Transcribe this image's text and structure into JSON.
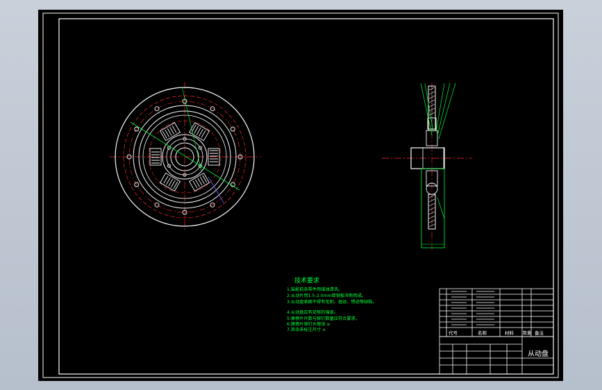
{
  "drawing": {
    "title_block_name": "从动盘",
    "technical_requirements": {
      "heading": "技术要求",
      "lines": [
        "1.装配前各零件用煤油清洗。",
        "2.从动片用1.5-2.0mm厚钢板冲制而成。",
        "3.从动盘表面不得有毛刺、斑纹、锈迹等缺陷。",
        "4.从动盘应有足够的强度。",
        "5.摩擦片片数与铆钉数量应符合要求。",
        "6.摩擦片铆钉头埋深 ≥",
        "7.其余未标注尺寸 ±"
      ]
    },
    "title_block": {
      "header_cells": [
        "代号",
        "名称",
        "材料",
        "数量",
        "备注"
      ]
    },
    "colors": {
      "paper": "#000000",
      "frame": "#ffffff",
      "outline": "#ffffff",
      "center_line": "#ff2a2a",
      "dimension": "#00ff3a",
      "hatch": "#ffffff",
      "leader": "#6a5cff",
      "background": "#c0c8d3"
    }
  }
}
